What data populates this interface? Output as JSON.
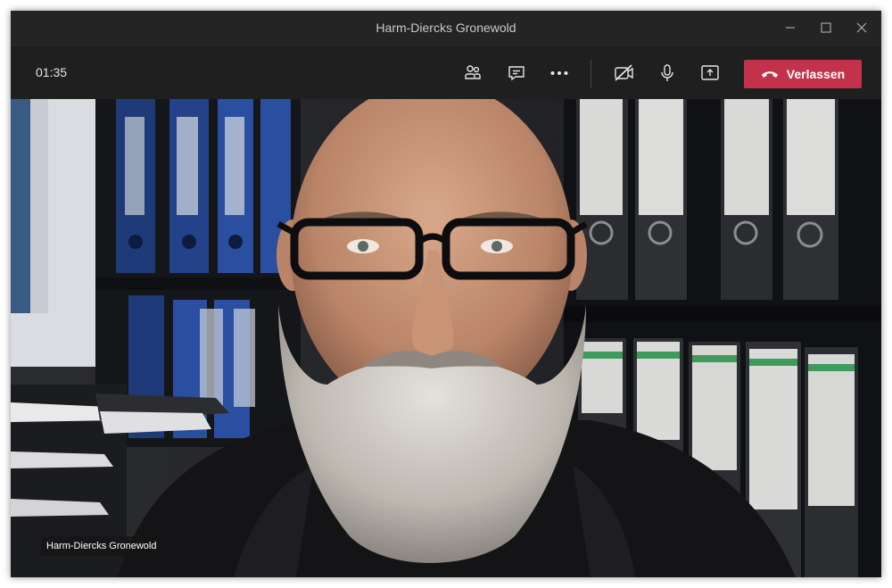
{
  "window": {
    "title": "Harm-Diercks Gronewold",
    "controls": {
      "minimize": "minimize-icon",
      "maximize": "maximize-icon",
      "close": "close-icon"
    }
  },
  "toolbar": {
    "timer": "01:35",
    "icons": [
      "participants-icon",
      "chat-icon",
      "more-options-icon",
      "camera-off-icon",
      "microphone-icon",
      "share-screen-icon"
    ],
    "leave_label": "Verlassen",
    "leave_color": "#c4314b"
  },
  "video": {
    "participant_name": "Harm-Diercks Gronewold"
  }
}
